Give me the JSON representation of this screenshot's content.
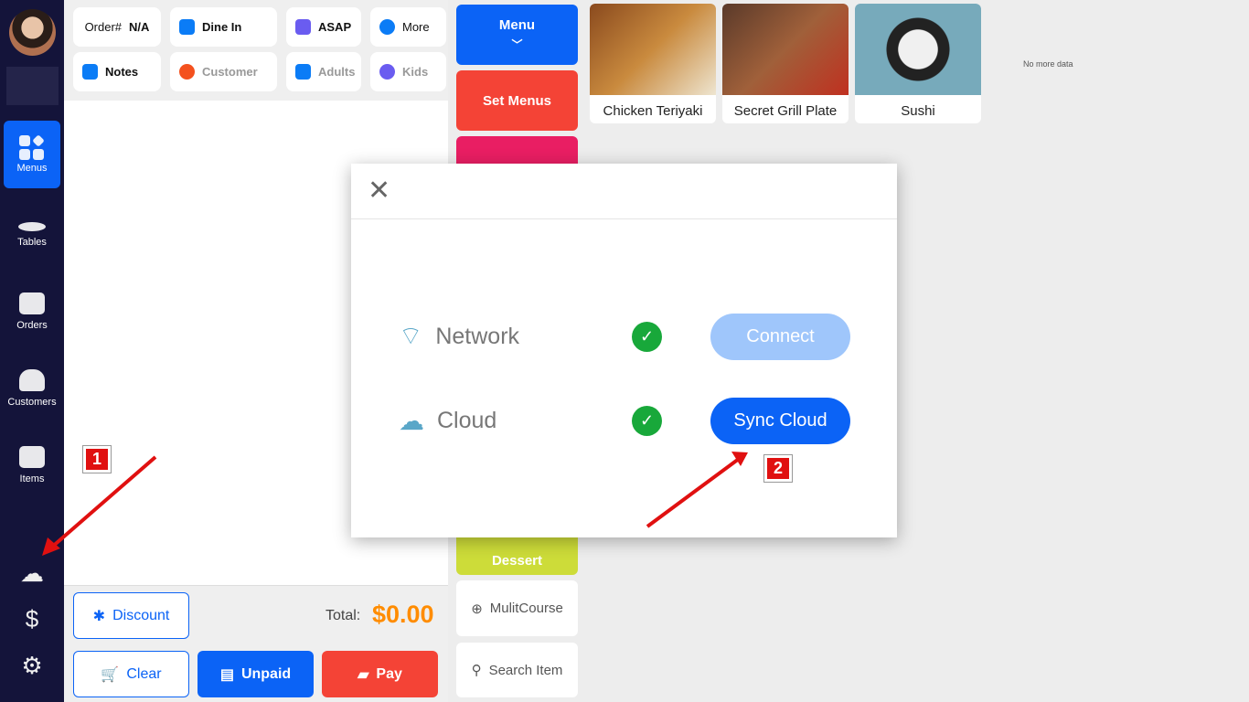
{
  "sidebar": {
    "items": [
      {
        "label": "Menus",
        "icon": "menus-icon",
        "active": true
      },
      {
        "label": "Tables",
        "icon": "table-icon"
      },
      {
        "label": "Orders",
        "icon": "orders-icon"
      },
      {
        "label": "Customers",
        "icon": "customers-icon"
      },
      {
        "label": "Items",
        "icon": "items-icon"
      }
    ],
    "bottom_icons": [
      "cloud-check-icon",
      "cash-drawer-icon",
      "gear-icon"
    ]
  },
  "order": {
    "order_label": "Order#",
    "order_value": "N/A",
    "dine_in": "Dine In",
    "asap": "ASAP",
    "more": "More",
    "notes": "Notes",
    "customer": "Customer",
    "adults": "Adults",
    "kids": "Kids",
    "discount": "Discount",
    "total_label": "Total:",
    "total_value": "$0.00",
    "clear": "Clear",
    "unpaid": "Unpaid",
    "pay": "Pay"
  },
  "categories": [
    {
      "label": "Menu",
      "color": "#0b63f6"
    },
    {
      "label": "Set Menus",
      "color": "#f44336"
    },
    {
      "label": "",
      "color": "#e91e63"
    },
    {
      "label": "Dessert",
      "color": "#cddc39"
    }
  ],
  "extra": {
    "multicourse": "MulitCourse",
    "search": "Search Item"
  },
  "items": [
    {
      "name": "Chicken Teriyaki"
    },
    {
      "name": "Secret Grill Plate"
    },
    {
      "name": "Sushi"
    }
  ],
  "no_more": "No more data",
  "modal": {
    "rows": [
      {
        "label": "Network",
        "status": "connected",
        "button": "Connect",
        "enabled": false
      },
      {
        "label": "Cloud",
        "status": "connected",
        "button": "Sync Cloud",
        "enabled": true
      }
    ]
  },
  "annotations": [
    "1",
    "2"
  ],
  "colors": {
    "accent": "#0b63f6",
    "total": "#ff8c00",
    "pay": "#f44336",
    "success": "#18a83a"
  }
}
